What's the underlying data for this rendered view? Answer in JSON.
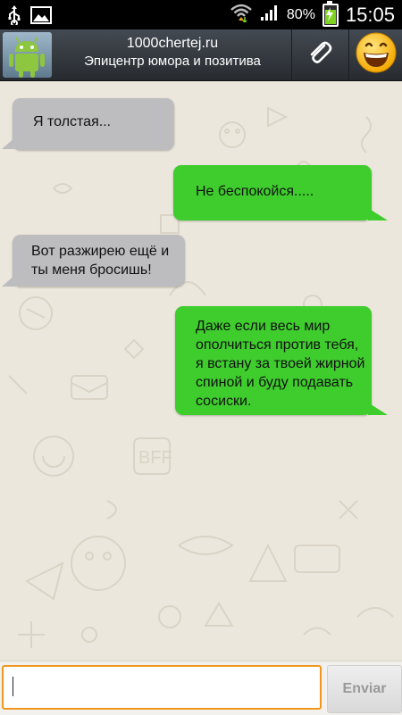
{
  "status_bar": {
    "battery": "80%",
    "time": "15:05",
    "icons": [
      "usb-icon",
      "image-icon",
      "wifi-icon",
      "signal-icon",
      "battery-charging-icon"
    ]
  },
  "header": {
    "contact_name": "1000chertej.ru",
    "contact_status": "Эпицентр юмора и позитива",
    "avatar_icon": "android-robot-icon",
    "attach_icon": "paperclip-icon",
    "emoji_icon": "smiley-icon"
  },
  "messages": [
    {
      "direction": "incoming",
      "text": "Я толстая..."
    },
    {
      "direction": "outgoing",
      "text": "Не беспокойся....."
    },
    {
      "direction": "incoming",
      "lines": [
        "Вот разжирею ещё и",
        "ты меня бросишь!"
      ]
    },
    {
      "direction": "outgoing",
      "lines": [
        "Даже если весь мир",
        "ополчиться против тебя,",
        "я встану за твоей жирной",
        "спиной и буду подавать",
        "сосиски."
      ]
    }
  ],
  "composer": {
    "value": "",
    "send_label": "Enviar"
  },
  "colors": {
    "incoming_bubble": "#bdbdbf",
    "outgoing_bubble": "#3fcd2e",
    "input_border": "#f0961e",
    "chat_background": "#ece7dc"
  }
}
